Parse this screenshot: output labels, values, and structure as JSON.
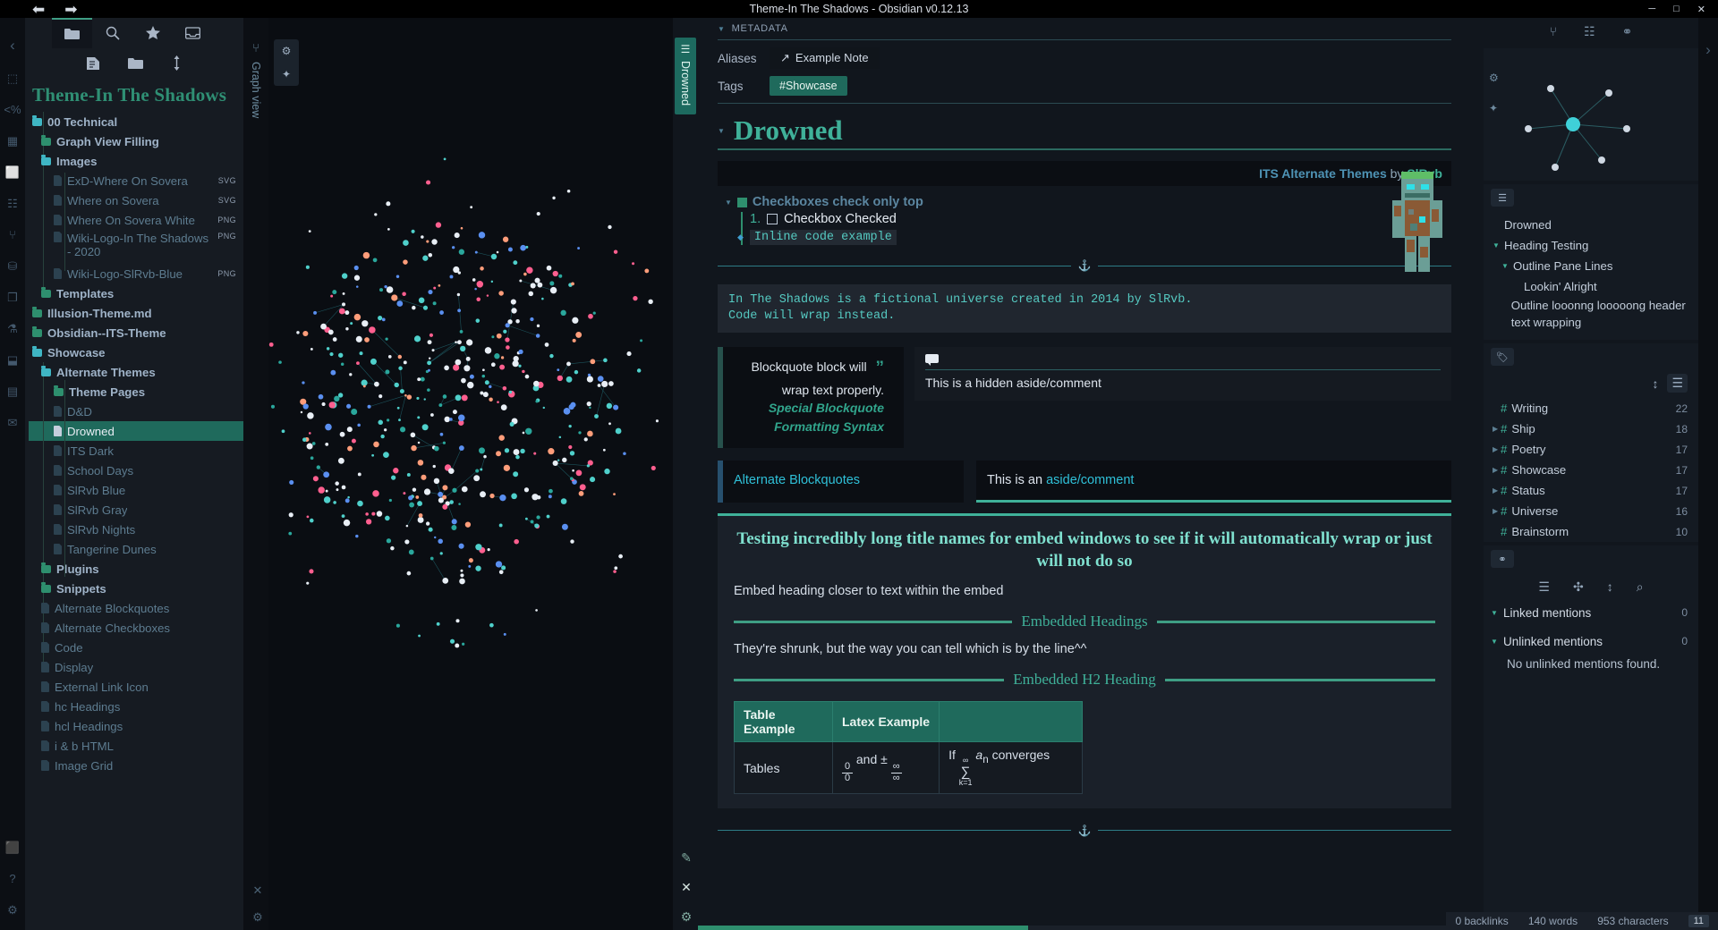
{
  "window": {
    "title": "Theme-In The Shadows - Obsidian v0.12.13",
    "back_icon": "⬅",
    "forward_icon": "➡",
    "minimize": "─",
    "maximize": "□",
    "close": "✕"
  },
  "ribbon": {
    "collapse_icon": "‹",
    "items": [
      {
        "name": "inbox-icon",
        "glyph": "⬚"
      },
      {
        "name": "code-percent-icon",
        "glyph": "<%"
      },
      {
        "name": "table-icon",
        "glyph": "▦"
      },
      {
        "name": "door-icon",
        "glyph": "⬜"
      },
      {
        "name": "calendar-icon",
        "glyph": "☷"
      },
      {
        "name": "git-icon",
        "glyph": "⑂"
      },
      {
        "name": "bookmark-icon",
        "glyph": "⛁"
      },
      {
        "name": "copy-icon",
        "glyph": "❐"
      },
      {
        "name": "flask-icon",
        "glyph": "⚗"
      },
      {
        "name": "archive-icon",
        "glyph": "⬓"
      },
      {
        "name": "grid-icon",
        "glyph": "▤"
      },
      {
        "name": "mail-icon",
        "glyph": "✉"
      }
    ],
    "bottom": [
      {
        "name": "shield-icon",
        "glyph": "⬛"
      },
      {
        "name": "help-icon",
        "glyph": "?"
      },
      {
        "name": "settings-icon",
        "glyph": "⚙"
      }
    ]
  },
  "explorer": {
    "tabs": [
      {
        "name": "files-tab",
        "glyph": "📁",
        "active": true
      },
      {
        "name": "search-tab",
        "glyph": "⌕",
        "active": false
      },
      {
        "name": "starred-tab",
        "glyph": "★",
        "active": false
      },
      {
        "name": "inbox-tab",
        "glyph": "⬒",
        "active": false
      }
    ],
    "tools": [
      {
        "name": "new-note-icon",
        "glyph": "☰"
      },
      {
        "name": "new-folder-icon",
        "glyph": "📁"
      },
      {
        "name": "sort-icon",
        "glyph": "↕"
      }
    ],
    "vault_title": "Theme-In The Shadows",
    "tree": [
      {
        "label": "00 Technical",
        "type": "folder",
        "indent": 0,
        "color": "cyan"
      },
      {
        "label": "Graph View Filling",
        "type": "folder",
        "indent": 1,
        "color": "green"
      },
      {
        "label": "Images",
        "type": "folder",
        "indent": 1,
        "color": "cyan"
      },
      {
        "label": "ExD-Where On Sovera",
        "type": "file",
        "indent": 2,
        "badge": "SVG"
      },
      {
        "label": "Where on Sovera",
        "type": "file",
        "indent": 2,
        "badge": "SVG"
      },
      {
        "label": "Where On Sovera White",
        "type": "file",
        "indent": 2,
        "badge": "PNG"
      },
      {
        "label": "Wiki-Logo-In The Shadows - 2020",
        "type": "file",
        "indent": 2,
        "badge": "PNG",
        "wrap": true
      },
      {
        "label": "Wiki-Logo-SlRvb-Blue",
        "type": "file",
        "indent": 2,
        "badge": "PNG"
      },
      {
        "label": "Templates",
        "type": "folder",
        "indent": 1,
        "color": "green"
      },
      {
        "label": "Illusion-Theme.md",
        "type": "folder",
        "indent": 0,
        "color": "green"
      },
      {
        "label": "Obsidian--ITS-Theme",
        "type": "folder",
        "indent": 0,
        "color": "green"
      },
      {
        "label": "Showcase",
        "type": "folder",
        "indent": 0,
        "color": "cyan"
      },
      {
        "label": "Alternate Themes",
        "type": "folder",
        "indent": 1,
        "color": "cyan"
      },
      {
        "label": "Theme Pages",
        "type": "folder",
        "indent": 2,
        "color": "green"
      },
      {
        "label": "D&D",
        "type": "file",
        "indent": 2
      },
      {
        "label": "Drowned",
        "type": "file",
        "indent": 2,
        "selected": true
      },
      {
        "label": "ITS Dark",
        "type": "file",
        "indent": 2
      },
      {
        "label": "School Days",
        "type": "file",
        "indent": 2
      },
      {
        "label": "SlRvb Blue",
        "type": "file",
        "indent": 2
      },
      {
        "label": "SlRvb Gray",
        "type": "file",
        "indent": 2
      },
      {
        "label": "SlRvb Nights",
        "type": "file",
        "indent": 2
      },
      {
        "label": "Tangerine Dunes",
        "type": "file",
        "indent": 2
      },
      {
        "label": "Plugins",
        "type": "folder",
        "indent": 1,
        "color": "green"
      },
      {
        "label": "Snippets",
        "type": "folder",
        "indent": 1,
        "color": "green"
      },
      {
        "label": "Alternate Blockquotes",
        "type": "file",
        "indent": 1
      },
      {
        "label": "Alternate Checkboxes",
        "type": "file",
        "indent": 1
      },
      {
        "label": "Code",
        "type": "file",
        "indent": 1
      },
      {
        "label": "Display",
        "type": "file",
        "indent": 1
      },
      {
        "label": "External Link Icon",
        "type": "file",
        "indent": 1
      },
      {
        "label": "hc Headings",
        "type": "file",
        "indent": 1
      },
      {
        "label": "hcl Headings",
        "type": "file",
        "indent": 1
      },
      {
        "label": "i & b HTML",
        "type": "file",
        "indent": 1
      },
      {
        "label": "Image Grid",
        "type": "file",
        "indent": 1
      }
    ]
  },
  "graph_pane": {
    "tab_label": "Graph view",
    "tab_icon": "⑂",
    "controls": [
      {
        "name": "graph-settings-icon",
        "glyph": "⚙"
      },
      {
        "name": "graph-magic-icon",
        "glyph": "✦"
      }
    ],
    "bottom": [
      {
        "name": "close-graph-icon",
        "glyph": "✕"
      },
      {
        "name": "graph-gear-icon",
        "glyph": "⚙"
      }
    ]
  },
  "editor": {
    "tab_label": "Drowned",
    "tab_icon": "☰",
    "bottom_icons": [
      {
        "name": "edit-pencil-icon",
        "glyph": "✎"
      },
      {
        "name": "close-pane-icon",
        "glyph": "✕"
      },
      {
        "name": "pane-settings-icon",
        "glyph": "⚙"
      }
    ],
    "metadata": {
      "header": "METADATA",
      "alias_key": "Aliases",
      "alias_value": "Example Note",
      "alias_icon": "↗",
      "tags_key": "Tags",
      "tag_value": "#Showcase"
    },
    "title": "Drowned",
    "banner": {
      "link_text": "ITS Alternate Themes",
      "by": "by",
      "author": "SlRvb"
    },
    "checkbox_block": {
      "heading": "Checkboxes check only top",
      "number": "1.",
      "item": "Checkbox Checked",
      "inline_code": "Inline code example"
    },
    "codeblock": [
      "In The Shadows is a fictional universe created in 2014 by SlRvb.",
      "Code will wrap instead."
    ],
    "blockquote": {
      "line1": "Blockquote block will",
      "line2": "wrap text properly.",
      "quote_mark": "”",
      "special1": "Special Blockquote",
      "special2": "Formatting Syntax"
    },
    "hidden_aside": "This is a hidden aside/comment",
    "alternate_blockquote": "Alternate Blockquotes",
    "alternate_aside_prefix": "This is an ",
    "alternate_aside_link": "aside/comment",
    "embed": {
      "title": "Testing incredibly long title names for embed windows to see if it will automatically wrap or just will not do so",
      "paragraph": "Embed heading closer to text within the embed",
      "heading1": "Embedded Headings",
      "paragraph2": "They're shrunk, but the way you can tell which is by the line^^",
      "heading2": "Embedded H2 Heading"
    },
    "table": {
      "headers": [
        "Table Example",
        "Latex Example",
        ""
      ],
      "rows": [
        [
          "Tables",
          "0/0 and ± ∞/∞",
          "If ∑ converges"
        ]
      ],
      "latex_frac_num": "0",
      "latex_frac_den": "0",
      "latex_mid": "and",
      "latex_pm": "±",
      "latex_inf_num": "∞",
      "latex_inf_den": "∞",
      "latex_if": "If",
      "latex_sum": "∑",
      "latex_sum_top": "∞",
      "latex_sum_bot": "k=1",
      "latex_an": "a",
      "latex_an_sub": "n",
      "latex_tail": "converges"
    },
    "anchor_icon": "⚓"
  },
  "right_sidebar": {
    "tabs": [
      {
        "name": "graph-tab-icon",
        "glyph": "⑂"
      },
      {
        "name": "calendar-tab-icon",
        "glyph": "☷"
      },
      {
        "name": "link-tab-icon",
        "glyph": "⚭"
      }
    ],
    "graph_icons": [
      {
        "name": "graph-settings-icon",
        "glyph": "⚙"
      },
      {
        "name": "graph-magic-icon",
        "glyph": "✦"
      }
    ],
    "outline_icon": "☰",
    "outline": [
      {
        "label": "Drowned",
        "indent": 0,
        "caret": false
      },
      {
        "label": "Heading Testing",
        "indent": 0,
        "caret": true
      },
      {
        "label": "Outline Pane Lines",
        "indent": 1,
        "caret": true
      },
      {
        "label": "Lookin' Alright",
        "indent": 2,
        "caret": false
      },
      {
        "label": "Outline looonng looooong header text wrapping",
        "indent": 1,
        "caret": false,
        "wrap": true
      }
    ],
    "tags_icon": "🏷",
    "tag_tools": [
      {
        "name": "tag-sort-icon",
        "glyph": "↕"
      },
      {
        "name": "tag-nest-icon",
        "glyph": "☰"
      }
    ],
    "tags": [
      {
        "name": "Writing",
        "count": "22",
        "caret": false
      },
      {
        "name": "Ship",
        "count": "18",
        "caret": true
      },
      {
        "name": "Poetry",
        "count": "17",
        "caret": true
      },
      {
        "name": "Showcase",
        "count": "17",
        "caret": true
      },
      {
        "name": "Status",
        "count": "17",
        "caret": true
      },
      {
        "name": "Universe",
        "count": "16",
        "caret": true
      },
      {
        "name": "Brainstorm",
        "count": "10",
        "caret": false
      }
    ],
    "backlinks_icon": "⚭",
    "backlink_tools": [
      {
        "name": "collapse-results-icon",
        "glyph": "☰"
      },
      {
        "name": "more-context-icon",
        "glyph": "✣"
      },
      {
        "name": "sort-order-icon",
        "glyph": "↕"
      },
      {
        "name": "search-backlinks-icon",
        "glyph": "⌕"
      }
    ],
    "linked_mentions": {
      "label": "Linked mentions",
      "count": "0"
    },
    "unlinked_mentions": {
      "label": "Unlinked mentions",
      "count": "0"
    },
    "no_unlinked": "No unlinked mentions found.",
    "rail_icon": "›"
  },
  "statusbar": {
    "backlinks": "0 backlinks",
    "words": "140 words",
    "characters": "953 characters",
    "page_indicator": "11"
  },
  "colors": {
    "accent": "#3fb199",
    "selection": "#1f6a5c",
    "bg": "#11161d",
    "sidebar_bg": "#161b22",
    "cyan": "#2fc0d8"
  }
}
